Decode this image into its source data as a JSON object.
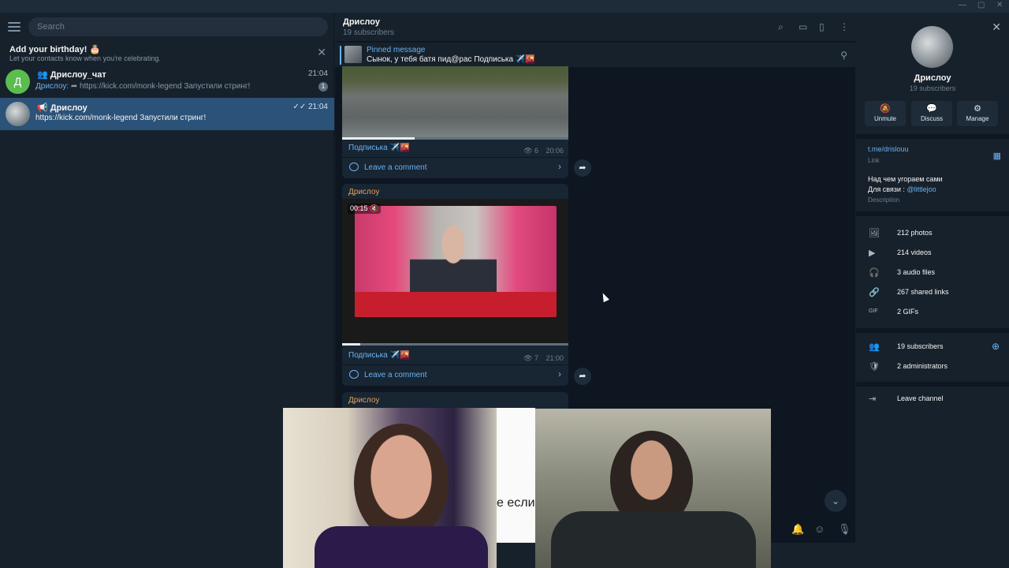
{
  "window": {
    "minimize": "—",
    "maximize": "▢",
    "close": "✕"
  },
  "sidebar": {
    "search_placeholder": "Search",
    "birthday": {
      "title": "Add your birthday! 🎂",
      "subtitle": "Let your contacts know when you're celebrating."
    },
    "chats": [
      {
        "avatar_letter": "Д",
        "name": "Дрислоу_чат",
        "time": "21:04",
        "sender": "Дрислоу:",
        "preview": " ➦ https://kick.com/monk-legend  Запустили стринг!",
        "unread": "1"
      },
      {
        "name": "📢 Дрислоу",
        "time": "✓✓ 21:04",
        "preview": "https://kick.com/monk-legend  Запустили стринг!"
      }
    ]
  },
  "chat": {
    "title": "Дрислоу",
    "subtitle": "19 subscribers",
    "pinned": {
      "title": "Pinned message",
      "text": "Сынок, у тебя батя пид@рас Подписька ✈️🌇"
    },
    "messages": [
      {
        "caption": "Подписька ✈️🌇",
        "views": "👁 6",
        "time": "20:06",
        "comment_label": "Leave a comment",
        "progress": 0.32
      },
      {
        "sender": "Дрислоу",
        "video_time": "00:15 🔇",
        "caption": "Подписька ✈️🌇",
        "views": "👁 7",
        "time": "21:00",
        "comment_label": "Leave a comment",
        "progress": 0.08
      },
      {
        "sender": "Дрислоу"
      }
    ],
    "overlay_text": "е если"
  },
  "info": {
    "name": "Дрислоу",
    "subscribers": "19 subscribers",
    "actions": [
      {
        "icon": "🔕",
        "label": "Unmute"
      },
      {
        "icon": "💬",
        "label": "Discuss"
      },
      {
        "icon": "⚙",
        "label": "Manage"
      }
    ],
    "link": "t.me/drislouu",
    "link_label": "Link",
    "description_line1": "Над чем угораем сами",
    "description_line2_prefix": "Для связи : ",
    "description_mention": "@littlejoo",
    "description_label": "Description",
    "media": [
      {
        "icon": "🖼",
        "label": "212 photos"
      },
      {
        "icon": "▶",
        "label": "214 videos"
      },
      {
        "icon": "🎧",
        "label": "3 audio files"
      },
      {
        "icon": "🔗",
        "label": "267 shared links"
      },
      {
        "icon": "GIF",
        "label": "2 GIFs"
      }
    ],
    "members": [
      {
        "icon": "👥",
        "label": "19 subscribers"
      },
      {
        "icon": "🛡",
        "label": "2 administrators"
      }
    ],
    "leave": {
      "icon": "⇥",
      "label": "Leave channel"
    }
  }
}
